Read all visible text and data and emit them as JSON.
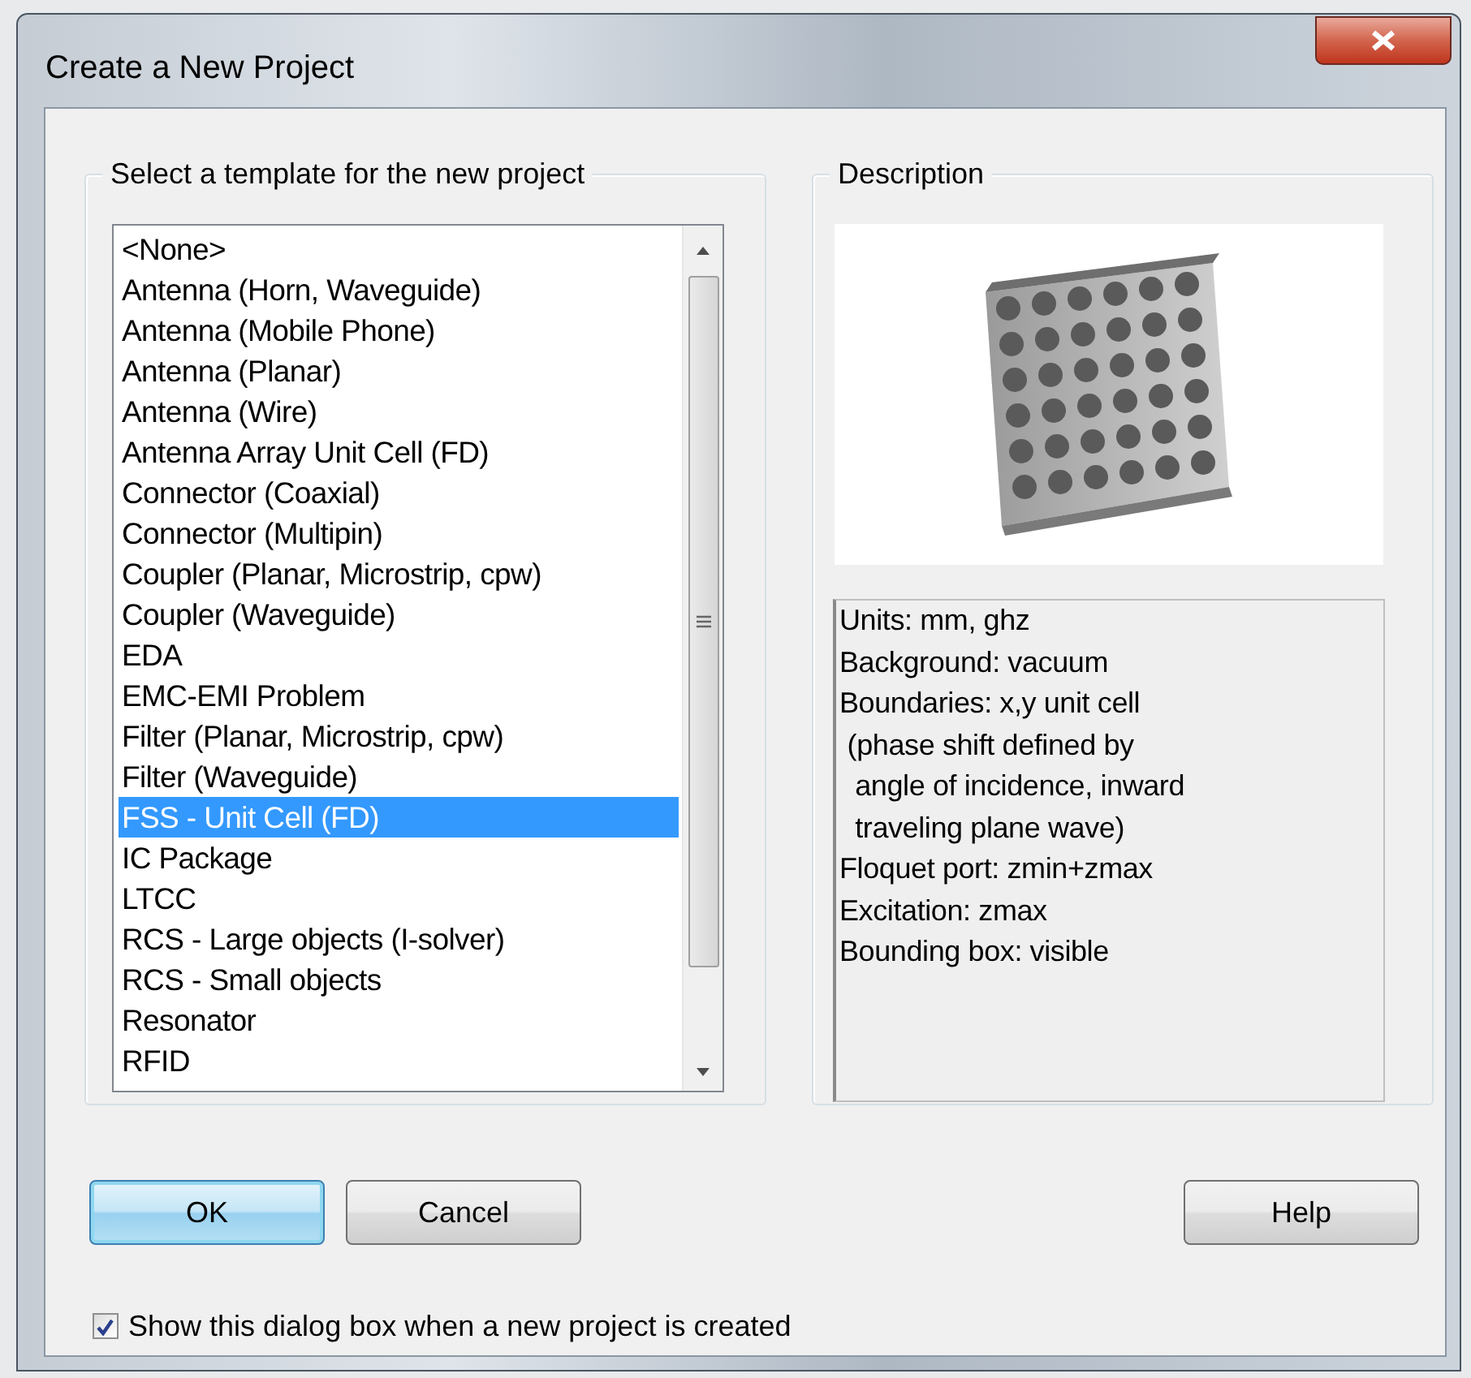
{
  "window": {
    "title": "Create a New Project"
  },
  "template_group": {
    "label": "Select a template for the new project"
  },
  "templates": [
    {
      "label": "<None>",
      "selected": false
    },
    {
      "label": "Antenna (Horn, Waveguide)",
      "selected": false
    },
    {
      "label": "Antenna (Mobile Phone)",
      "selected": false
    },
    {
      "label": "Antenna (Planar)",
      "selected": false
    },
    {
      "label": "Antenna (Wire)",
      "selected": false
    },
    {
      "label": "Antenna Array Unit Cell (FD)",
      "selected": false
    },
    {
      "label": "Connector (Coaxial)",
      "selected": false
    },
    {
      "label": "Connector (Multipin)",
      "selected": false
    },
    {
      "label": "Coupler (Planar, Microstrip, cpw)",
      "selected": false
    },
    {
      "label": "Coupler (Waveguide)",
      "selected": false
    },
    {
      "label": "EDA",
      "selected": false
    },
    {
      "label": "EMC-EMI Problem",
      "selected": false
    },
    {
      "label": "Filter (Planar, Microstrip, cpw)",
      "selected": false
    },
    {
      "label": "Filter (Waveguide)",
      "selected": false
    },
    {
      "label": "FSS - Unit Cell (FD)",
      "selected": true
    },
    {
      "label": "IC Package",
      "selected": false
    },
    {
      "label": "LTCC",
      "selected": false
    },
    {
      "label": "RCS - Large objects (I-solver)",
      "selected": false
    },
    {
      "label": "RCS - Small objects",
      "selected": false
    },
    {
      "label": "Resonator",
      "selected": false
    },
    {
      "label": "RFID",
      "selected": false
    }
  ],
  "description_group": {
    "label": "Description"
  },
  "description": {
    "text": "Units: mm, ghz\nBackground: vacuum\nBoundaries: x,y unit cell\n (phase shift defined by\n  angle of incidence, inward\n  traveling plane wave)\nFloquet port: zmin+zmax\nExcitation: zmax\nBounding box: visible"
  },
  "buttons": [
    {
      "label": "OK",
      "default": true
    },
    {
      "label": "Cancel",
      "default": false
    }
  ],
  "help_button": {
    "label": "Help",
    "default": false
  },
  "show_dialog_checkbox": {
    "label": "Show this dialog box when a new project is created",
    "checked": true
  }
}
